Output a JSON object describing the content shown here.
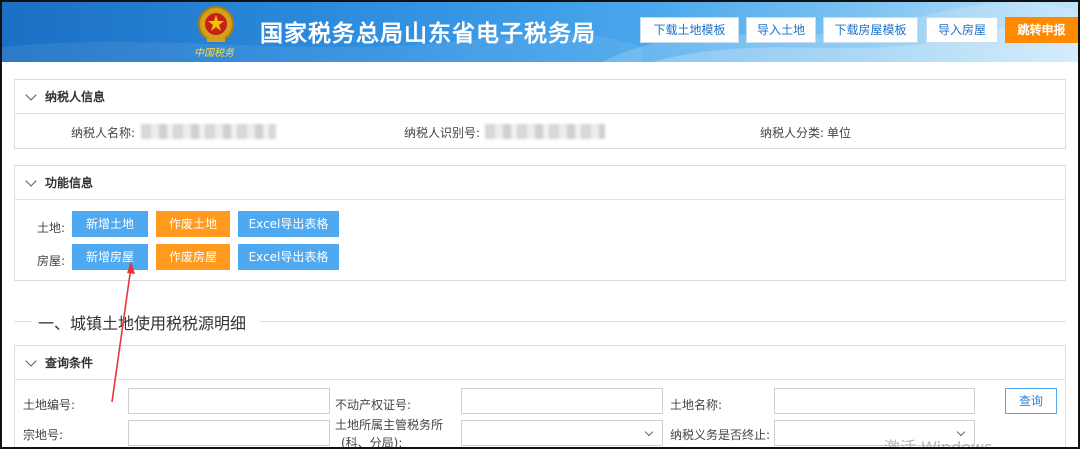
{
  "header": {
    "title": "国家税务总局山东省电子税务局",
    "emblem_caption": "中国税务",
    "buttons": [
      "下载土地模板",
      "导入土地",
      "下载房屋模板",
      "导入房屋",
      "跳转申报"
    ],
    "colors": {
      "bar": "#2f8fe0",
      "jump": "#ff8a00"
    }
  },
  "taxpayer": {
    "section_title": "纳税人信息",
    "name_label": "纳税人名称:",
    "id_label": "纳税人识别号:",
    "category_label": "纳税人分类:",
    "category_value": "单位"
  },
  "functions": {
    "section_title": "功能信息",
    "land_label": "土地:",
    "house_label": "房屋:",
    "land_buttons": {
      "add": "新增土地",
      "void": "作废土地",
      "export": "Excel导出表格"
    },
    "house_buttons": {
      "add": "新增房屋",
      "void": "作废房屋",
      "export": "Excel导出表格"
    }
  },
  "main": {
    "section_heading": "一、城镇土地使用税税源明细"
  },
  "query": {
    "section_title": "查询条件",
    "land_no_label": "土地编号:",
    "cert_label": "不动产权证号:",
    "land_name_label": "土地名称:",
    "query_button": "查询",
    "parcel_label": "宗地号:",
    "tax_office_label_1": "土地所属主管税务所",
    "tax_office_label_2": "(科、分局):",
    "terminated_label": "纳税义务是否终止:"
  },
  "watermark": "激活 Windows"
}
